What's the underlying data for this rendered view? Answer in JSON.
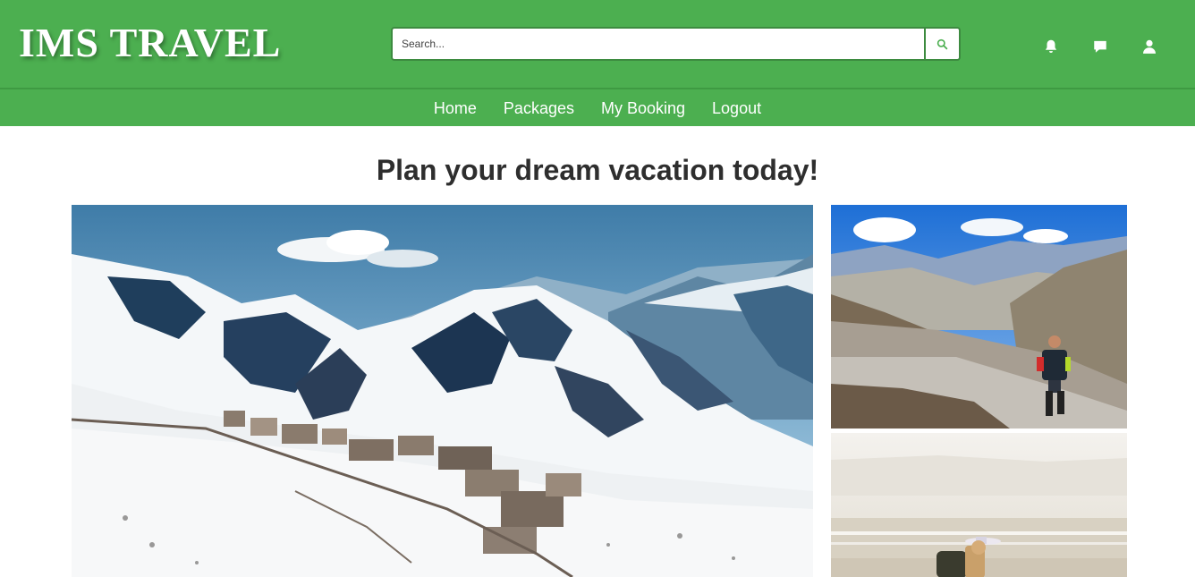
{
  "brand": {
    "name": "IMS TRAVEL"
  },
  "search": {
    "placeholder": "Search...",
    "button_icon": "search-icon"
  },
  "header_icons": [
    "bell-icon",
    "chat-icon",
    "user-icon"
  ],
  "nav": {
    "items": [
      {
        "label": "Home"
      },
      {
        "label": "Packages"
      },
      {
        "label": "My Booking"
      },
      {
        "label": "Logout"
      }
    ]
  },
  "hero": {
    "headline": "Plan your dream vacation today!"
  },
  "gallery": [
    {
      "subject": "snow-covered mountain village"
    },
    {
      "subject": "hiker on mountain trail"
    },
    {
      "subject": "traveler with backpack at sea"
    }
  ],
  "colors": {
    "brand_green": "#4caf50",
    "headline_text": "#2e2e2e"
  }
}
